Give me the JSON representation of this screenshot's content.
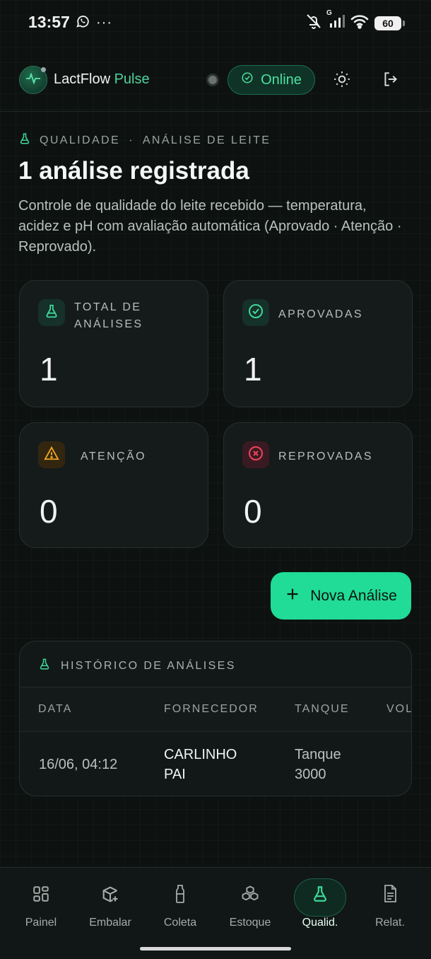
{
  "status_bar": {
    "time": "13:57",
    "battery": "60",
    "network_label": "G"
  },
  "header": {
    "brand_main": "LactFlow",
    "brand_accent": "Pulse",
    "online_label": "Online"
  },
  "page": {
    "eyebrow_section": "QUALIDADE",
    "eyebrow_separator": "·",
    "eyebrow_sub": "ANÁLISE DE LEITE",
    "title": "1 análise registrada",
    "description": "Controle de qualidade do leite recebido — temperatura, acidez e pH com avaliação automática (Aprovado · Atenção · Reprovado)."
  },
  "stats": {
    "total": {
      "label": "TOTAL DE ANÁLISES",
      "value": "1",
      "icon": "flask-icon"
    },
    "approved": {
      "label": "APROVADAS",
      "value": "1",
      "icon": "check-circle-icon"
    },
    "attention": {
      "label": "ATENÇÃO",
      "value": "0",
      "icon": "warning-icon"
    },
    "rejected": {
      "label": "REPROVADAS",
      "value": "0",
      "icon": "x-circle-icon"
    }
  },
  "actions": {
    "new_analysis": "Nova Análise"
  },
  "history": {
    "title": "HISTÓRICO DE ANÁLISES",
    "columns": [
      "DATA",
      "FORNECEDOR",
      "TANQUE",
      "VOL"
    ],
    "rows": [
      {
        "date": "16/06, 04:12",
        "supplier": "CARLINHO PAI",
        "tank": "Tanque 3000",
        "volume": ""
      }
    ]
  },
  "nav": {
    "items": [
      {
        "label": "Painel",
        "icon": "grid-icon"
      },
      {
        "label": "Embalar",
        "icon": "package-plus-icon"
      },
      {
        "label": "Coleta",
        "icon": "milk-bottle-icon"
      },
      {
        "label": "Estoque",
        "icon": "boxes-icon"
      },
      {
        "label": "Qualid.",
        "icon": "flask-icon"
      },
      {
        "label": "Relat.",
        "icon": "report-icon"
      }
    ],
    "active_index": 4
  },
  "colors": {
    "accent": "#20dc96",
    "success": "#3ed89a",
    "warning": "#f0a521",
    "danger": "#f0445a",
    "background": "#0d1211"
  }
}
